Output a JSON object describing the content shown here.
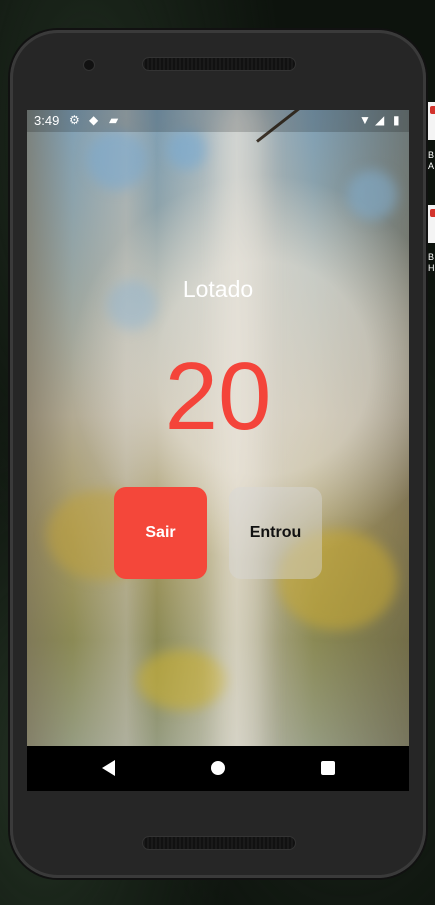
{
  "status_bar": {
    "time": "3:49",
    "left_icons": [
      "settings-icon",
      "shield-icon",
      "sd-card-icon"
    ],
    "right_icons": [
      "wifi-icon",
      "signal-icon",
      "battery-icon"
    ]
  },
  "app": {
    "status_label": "Lotado",
    "count": "20",
    "exit_button": "Sair",
    "enter_button": "Entrou"
  },
  "nav_bar": {
    "buttons": [
      "back-icon",
      "home-icon",
      "recents-icon"
    ]
  },
  "side_thumbnails": {
    "first_text": "B\nA",
    "second_text": "B\nH"
  },
  "colors": {
    "accent_red": "#f4473a",
    "count_red": "#f4443a",
    "phone_body": "#262626"
  }
}
